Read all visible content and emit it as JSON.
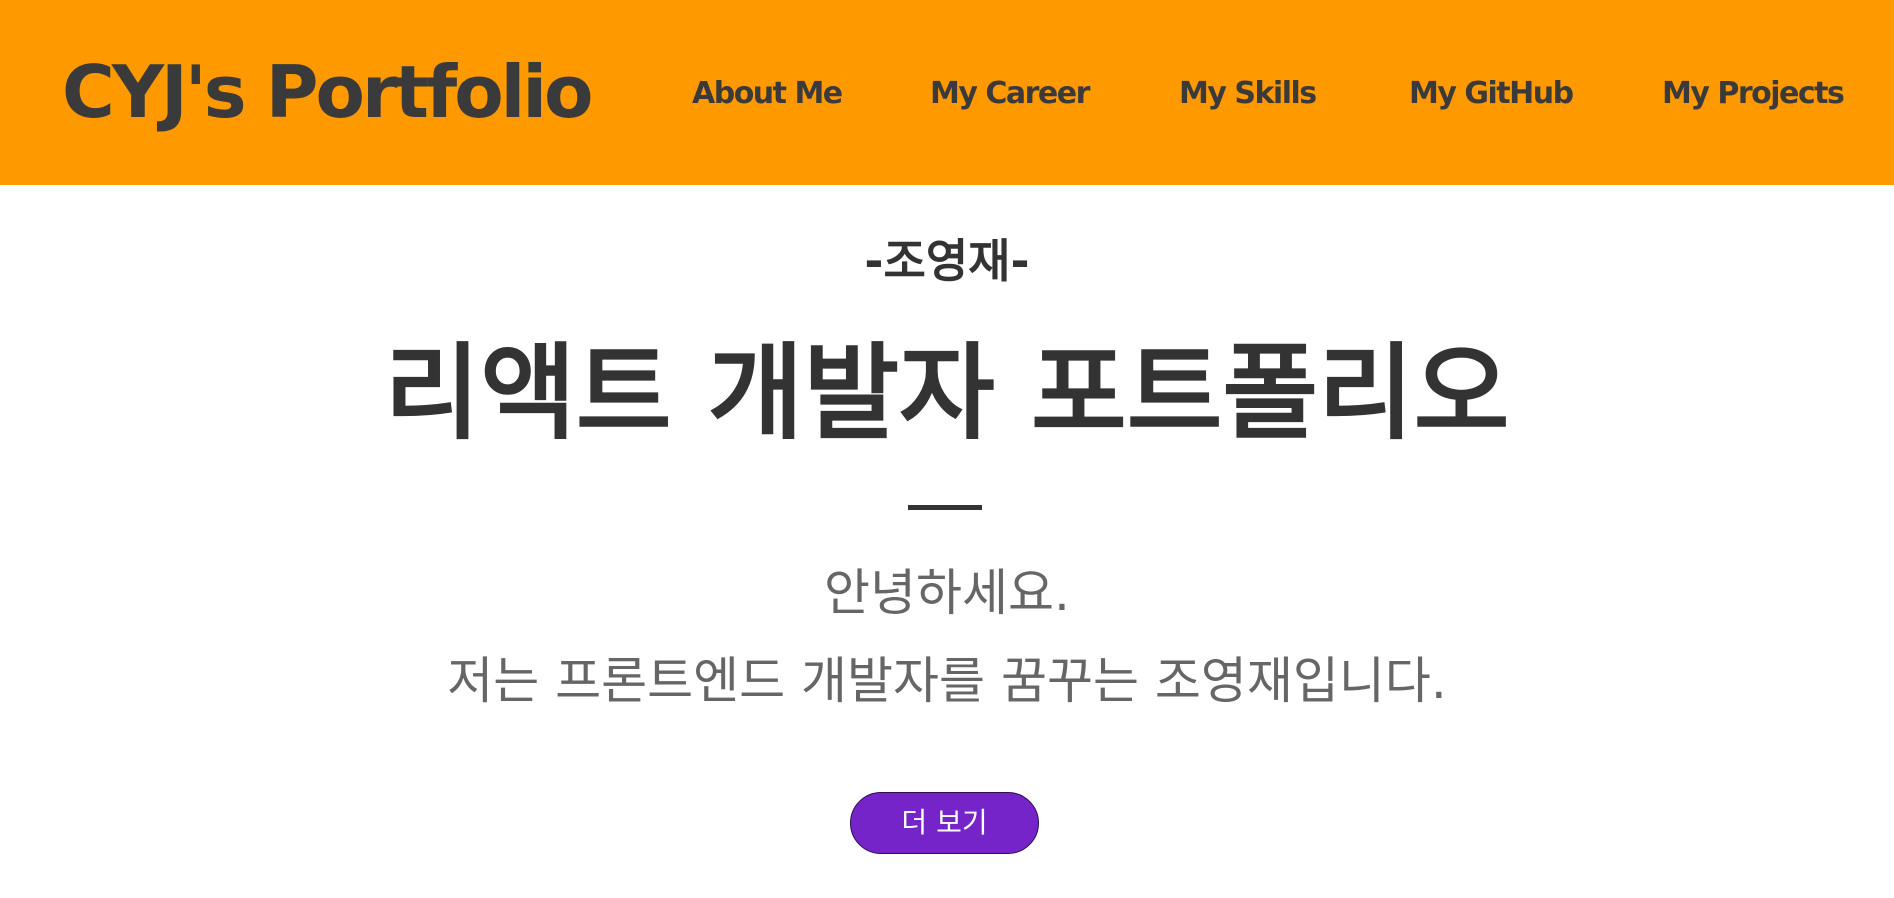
{
  "header": {
    "logo": "CYJ's Portfolio",
    "nav": [
      {
        "label": "About Me"
      },
      {
        "label": "My Career"
      },
      {
        "label": "My Skills"
      },
      {
        "label": "My GitHub"
      },
      {
        "label": "My Projects"
      }
    ]
  },
  "hero": {
    "name": "-조영재-",
    "title": "리액트 개발자 포트폴리오",
    "intro_line_1": "안녕하세요.",
    "intro_line_2": "저는 프론트엔드 개발자를 꿈꾸는 조영재입니다.",
    "button_label": "더 보기"
  },
  "colors": {
    "header_bg": "#ff9900",
    "text_dark": "#333333",
    "text_muted": "#666666",
    "button_bg": "#7424c9"
  }
}
